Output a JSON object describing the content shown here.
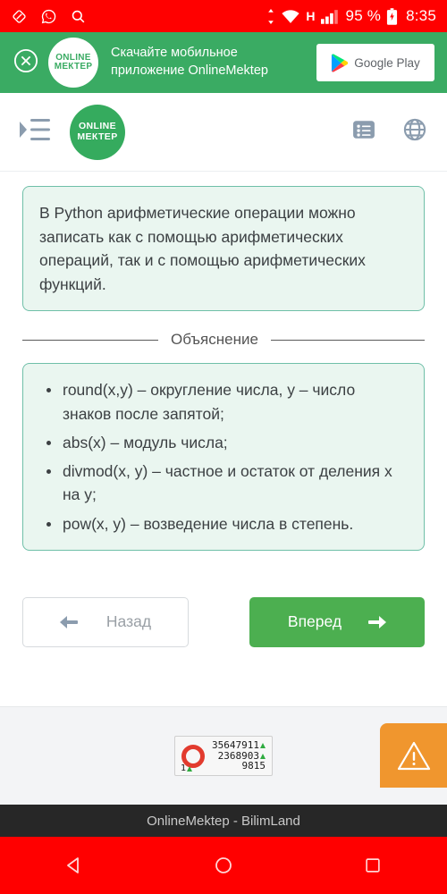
{
  "status_bar": {
    "background": "#ff0000",
    "left_icons": [
      "rotation-lock-icon",
      "whatsapp-icon",
      "search-icon"
    ],
    "sync_icon": "sync-arrows-icon",
    "wifi_icon": "wifi-icon",
    "network_type": "H",
    "signal_icon": "signal-bars-icon",
    "battery_percent": "95 %",
    "battery_icon": "battery-charging-icon",
    "time": "8:35"
  },
  "promo_banner": {
    "background": "#3aab63",
    "close_icon": "close-circle-icon",
    "logo_line1": "ONLINE",
    "logo_line2": "МЕКТЕР",
    "text_line1": "Скачайте мобильное",
    "text_line2": "приложение OnlineMektep",
    "store_button_label": "Google Play",
    "store_icon": "google-play-icon"
  },
  "toolbar": {
    "menu_icon": "menu-indent-icon",
    "logo_line1": "ONLINE",
    "logo_line2": "МЕКТЕР",
    "logo_background": "#35ab5e",
    "list_icon": "list-view-icon",
    "globe_icon": "globe-icon",
    "icon_color": "#8b9cae"
  },
  "content": {
    "intro_card": {
      "text": "В Python арифметические операции можно записать как с помощью арифметических операций, так и с помощью арифметических функций.",
      "background": "#eaf6f0",
      "border": "#6fbfa8"
    },
    "divider_label": "Объяснение",
    "explanation_card": {
      "background": "#eaf6f0",
      "border": "#6fbfa8",
      "items": [
        "round(x,y) – округление числа, y – число знаков после запятой;",
        "abs(x) – модуль числа;",
        "divmod(x, y) – частное и остаток от деления x на y;",
        "pow(x, y) – возведение числа в степень."
      ]
    },
    "nav": {
      "back_label": "Назад",
      "back_icon": "arrow-left-icon",
      "forward_label": "Вперед",
      "forward_icon": "arrow-right-icon",
      "forward_background": "#4caf50"
    }
  },
  "footer": {
    "counter": {
      "ring_color": "#e23b2e",
      "value_1": "35647911",
      "value_2": "2368903",
      "value_3": "1",
      "value_4": "9815",
      "trend_icon": "triangle-up-icon"
    },
    "warning_badge": {
      "icon": "warning-triangle-icon",
      "background": "#f0962e"
    }
  },
  "title_bar": {
    "title": "OnlineMektep - BilimLand",
    "background": "#272727"
  },
  "nav_bar": {
    "background": "#ff0000",
    "back_icon": "triangle-back-icon",
    "home_icon": "circle-home-icon",
    "recents_icon": "square-recents-icon"
  }
}
